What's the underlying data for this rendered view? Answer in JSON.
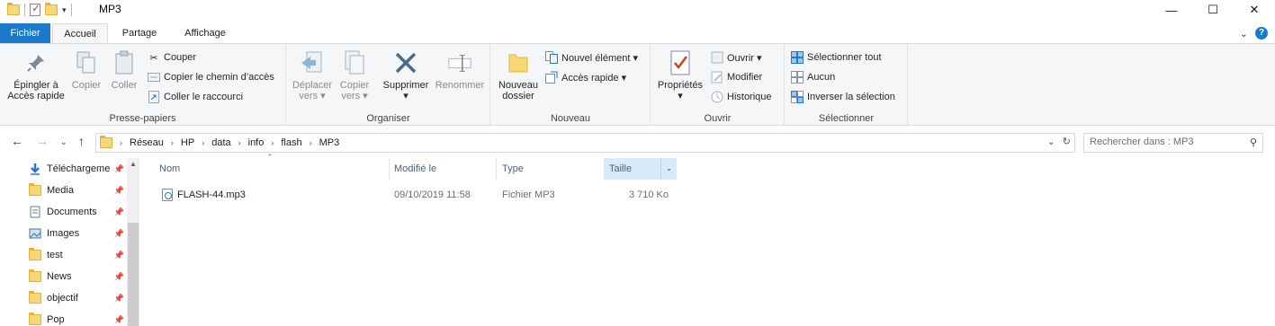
{
  "window": {
    "title": "MP3",
    "controls": {
      "minimize": "—",
      "maximize": "☐",
      "close": "✕"
    }
  },
  "tabs": {
    "file": "Fichier",
    "home": "Accueil",
    "share": "Partage",
    "view": "Affichage",
    "help_glyph": "?"
  },
  "ribbon": {
    "clipboard": {
      "label": "Presse-papiers",
      "pin": "Épingler à\nAccès rapide",
      "copy": "Copier",
      "paste": "Coller",
      "cut": "Couper",
      "copy_path": "Copier le chemin d’accès",
      "paste_shortcut": "Coller le raccourci"
    },
    "organize": {
      "label": "Organiser",
      "move_to": "Déplacer\nvers ▾",
      "copy_to": "Copier\nvers ▾",
      "delete": "Supprimer\n▾",
      "rename": "Renommer"
    },
    "new": {
      "label": "Nouveau",
      "new_folder": "Nouveau\ndossier",
      "new_item": "Nouvel élément ▾",
      "easy_access": "Accès rapide ▾"
    },
    "open": {
      "label": "Ouvrir",
      "properties": "Propriétés\n▾",
      "open": "Ouvrir ▾",
      "edit": "Modifier",
      "history": "Historique"
    },
    "select": {
      "label": "Sélectionner",
      "select_all": "Sélectionner tout",
      "select_none": "Aucun",
      "invert": "Inverser la sélection"
    }
  },
  "address": {
    "breadcrumb": [
      "Réseau",
      "HP",
      "data",
      "info",
      "flash",
      "MP3"
    ],
    "search_placeholder": "Rechercher dans : MP3"
  },
  "nav_pane": {
    "items": [
      {
        "label": "Téléchargeme",
        "icon": "download-arrow-icon"
      },
      {
        "label": "Media",
        "icon": "folder-icon"
      },
      {
        "label": "Documents",
        "icon": "documents-icon"
      },
      {
        "label": "Images",
        "icon": "pictures-icon"
      },
      {
        "label": "test",
        "icon": "folder-icon"
      },
      {
        "label": "News",
        "icon": "folder-icon"
      },
      {
        "label": "objectif",
        "icon": "folder-icon"
      },
      {
        "label": "Pop",
        "icon": "folder-icon"
      }
    ]
  },
  "file_list": {
    "columns": {
      "name": "Nom",
      "modified": "Modifié le",
      "type": "Type",
      "size": "Taille"
    },
    "rows": [
      {
        "name": "FLASH-44.mp3",
        "modified": "09/10/2019 11:58",
        "type": "Fichier MP3",
        "size": "3 710 Ko"
      }
    ]
  },
  "colors": {
    "accent": "#1979ca",
    "ribbon_bg": "#f5f6f7",
    "folder": "#f8d775",
    "selected_col": "#d9ebf9"
  }
}
